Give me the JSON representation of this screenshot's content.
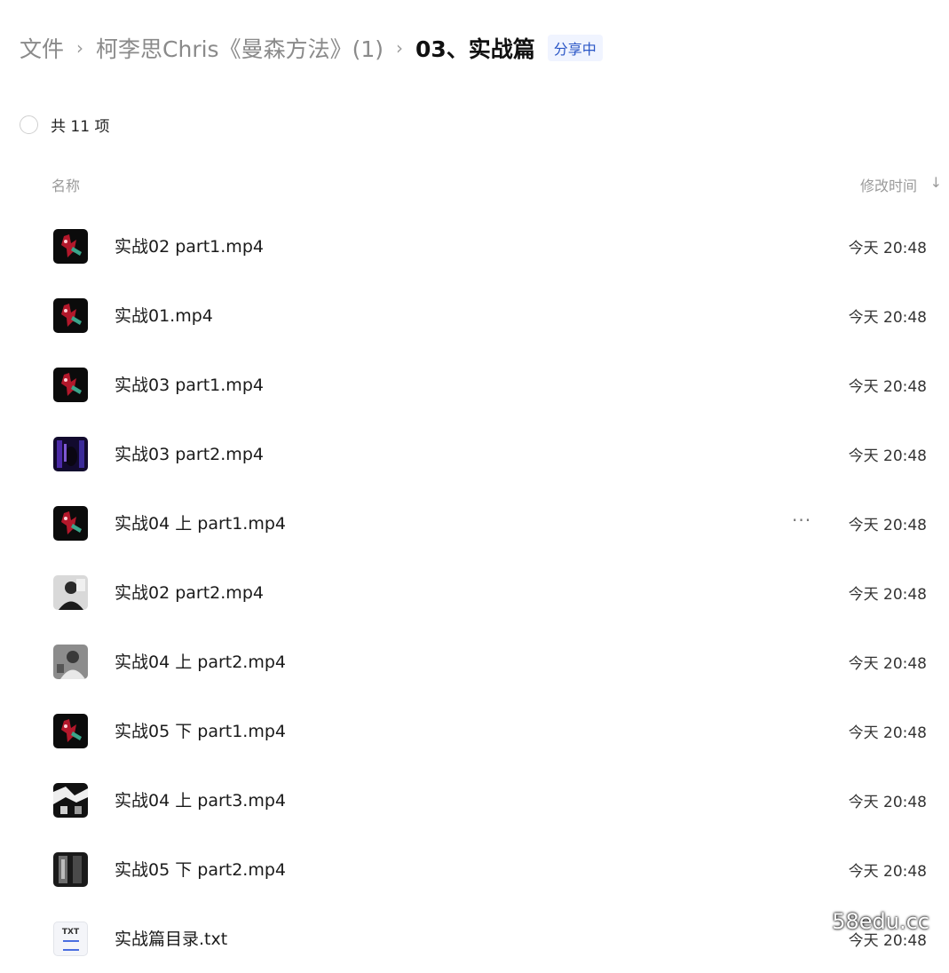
{
  "breadcrumb": {
    "items": [
      "文件",
      "柯李思Chris《曼森方法》(1)"
    ],
    "current": "03、实战篇",
    "share_status": "分享中"
  },
  "summary": {
    "count_text": "共 11 项"
  },
  "columns": {
    "name": "名称",
    "modified": "修改时间"
  },
  "files": [
    {
      "name": "实战02 part1.mp4",
      "time": "今天 20:48",
      "thumb": "red"
    },
    {
      "name": "实战01.mp4",
      "time": "今天 20:48",
      "thumb": "red"
    },
    {
      "name": "实战03 part1.mp4",
      "time": "今天 20:48",
      "thumb": "red"
    },
    {
      "name": "实战03 part2.mp4",
      "time": "今天 20:48",
      "thumb": "stage"
    },
    {
      "name": "实战04 上 part1.mp4",
      "time": "今天 20:48",
      "thumb": "red",
      "more": "···"
    },
    {
      "name": "实战02 part2.mp4",
      "time": "今天 20:48",
      "thumb": "person"
    },
    {
      "name": "实战04 上 part2.mp4",
      "time": "今天 20:48",
      "thumb": "person2"
    },
    {
      "name": "实战05 下 part1.mp4",
      "time": "今天 20:48",
      "thumb": "red"
    },
    {
      "name": "实战04 上 part3.mp4",
      "time": "今天 20:48",
      "thumb": "bw"
    },
    {
      "name": "实战05 下 part2.mp4",
      "time": "今天 20:48",
      "thumb": "dark"
    },
    {
      "name": "实战篇目录.txt",
      "time": "今天 20:48",
      "thumb": "txt",
      "thumb_label": "TXT"
    }
  ],
  "watermark": "58edu.cc"
}
